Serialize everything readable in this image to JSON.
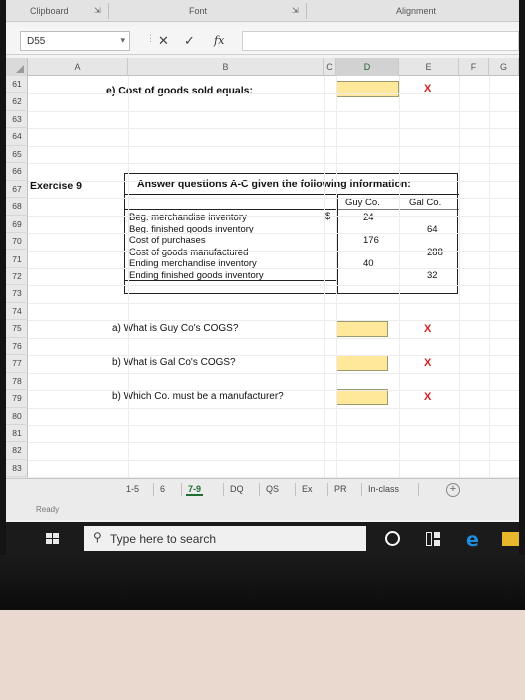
{
  "ribbon": {
    "clipboard": "Clipboard",
    "font": "Font",
    "alignment": "Alignment"
  },
  "formula_bar": {
    "name_box": "D55",
    "fx_label": "fx",
    "formula": ""
  },
  "columns": [
    "A",
    "B",
    "C",
    "D",
    "E",
    "F",
    "G"
  ],
  "rows": [
    "61",
    "62",
    "63",
    "64",
    "65",
    "66",
    "67",
    "68",
    "69",
    "70",
    "71",
    "72",
    "73",
    "74",
    "75",
    "76",
    "77",
    "78",
    "79",
    "80",
    "81",
    "82",
    "83"
  ],
  "sheet": {
    "q_e": "e) Cost of goods sold equals:",
    "q_e_answer": "X",
    "exercise_label": "Exercise 9",
    "instructions": "Answer questions A-C given the following information:",
    "table": {
      "headers": [
        "Guy Co.",
        "Gal Co."
      ],
      "currency_symbol": "$",
      "items": [
        {
          "label": "Beg. merchandise inventory",
          "guy": "24",
          "gal": ""
        },
        {
          "label": "Beg. finished goods inventory",
          "guy": "",
          "gal": "64"
        },
        {
          "label": "Cost of purchases",
          "guy": "176",
          "gal": ""
        },
        {
          "label": "Cost of goods manufactured",
          "guy": "",
          "gal": "288"
        },
        {
          "label": "Ending merchandise inventory",
          "guy": "40",
          "gal": ""
        },
        {
          "label": "Ending finished goods inventory",
          "guy": "",
          "gal": "32"
        }
      ]
    },
    "questions": [
      {
        "label": "a) What is Guy Co's COGS?",
        "answer": "X"
      },
      {
        "label": "b) What is Gal Co's COGS?",
        "answer": "X"
      },
      {
        "label": "b) Which Co. must be a manufacturer?",
        "answer": "X"
      }
    ]
  },
  "tabs": [
    "1-5",
    "6",
    "7-9",
    "DQ",
    "QS",
    "Ex",
    "PR",
    "In-class"
  ],
  "active_tab": "7-9",
  "status": "Ready",
  "taskbar": {
    "search_placeholder": "Type here to search",
    "edge_glyph": "e"
  },
  "colors": {
    "answer_fill": "#ffe89a",
    "answer_mark": "#d42020",
    "excel_green": "#1e6e30"
  }
}
